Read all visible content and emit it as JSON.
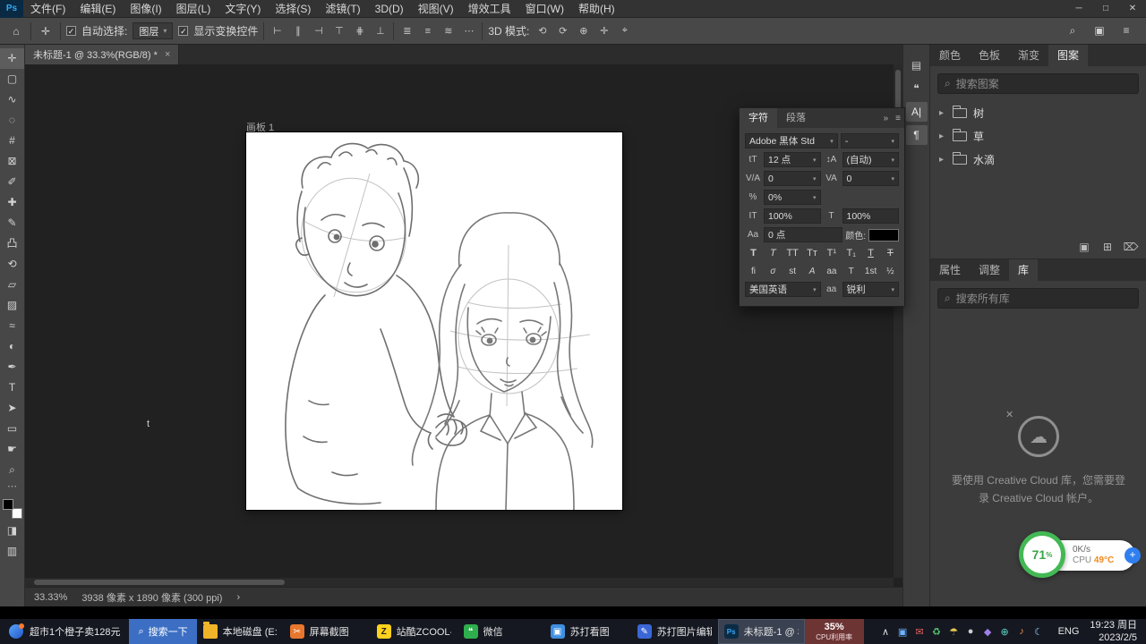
{
  "ui": {
    "dropdown_arrow": "▾",
    "check": "✓",
    "search_icon": "⌕",
    "disclosure": "▸"
  },
  "window": {
    "ps_logo": "Ps",
    "controls": {
      "minimize": "─",
      "maximize": "□",
      "close": "✕"
    }
  },
  "menubar": {
    "items": [
      "文件(F)",
      "编辑(E)",
      "图像(I)",
      "图层(L)",
      "文字(Y)",
      "选择(S)",
      "滤镜(T)",
      "3D(D)",
      "视图(V)",
      "增效工具",
      "窗口(W)",
      "帮助(H)"
    ]
  },
  "options_bar": {
    "home_icon": "⌂",
    "tool_icon": "✛",
    "auto_select_label": "自动选择:",
    "auto_select_value": "图层",
    "show_transform_label": "显示变换控件",
    "align_icons": [
      "⊢",
      "∥",
      "⊣",
      "⊤",
      "⋕",
      "⊥"
    ],
    "distribute_icons": [
      "≣",
      "≡",
      "≋"
    ],
    "more_icon": "⋯",
    "mode_3d_label": "3D 模式:",
    "mode_3d_icons": [
      "⟲",
      "⟳",
      "⊕",
      "✛",
      "⌖"
    ],
    "workspace_icon": "▣",
    "menu_icon": "≡"
  },
  "toolbar": {
    "tools": [
      {
        "name": "move",
        "glyph": "✛"
      },
      {
        "name": "marquee",
        "glyph": "▢"
      },
      {
        "name": "lasso",
        "glyph": "∿"
      },
      {
        "name": "quick-selection",
        "glyph": "◌"
      },
      {
        "name": "crop",
        "glyph": "#"
      },
      {
        "name": "frame",
        "glyph": "⊠"
      },
      {
        "name": "eyedropper",
        "glyph": "✐"
      },
      {
        "name": "spot-healing",
        "glyph": "✚"
      },
      {
        "name": "brush",
        "glyph": "✎"
      },
      {
        "name": "clone-stamp",
        "glyph": "凸"
      },
      {
        "name": "history-brush",
        "glyph": "⟲"
      },
      {
        "name": "eraser",
        "glyph": "▱"
      },
      {
        "name": "gradient",
        "glyph": "▨"
      },
      {
        "name": "blur",
        "glyph": "≈"
      },
      {
        "name": "dodge",
        "glyph": "◐"
      },
      {
        "name": "pen",
        "glyph": "✒"
      },
      {
        "name": "type",
        "glyph": "T"
      },
      {
        "name": "path-selection",
        "glyph": "➤"
      },
      {
        "name": "rectangle",
        "glyph": "▭"
      },
      {
        "name": "hand",
        "glyph": "☛"
      },
      {
        "name": "zoom",
        "glyph": "⌕"
      }
    ],
    "more_icon": "⋯",
    "mask_icon": "◨",
    "screen_mode_icon": "▥"
  },
  "document": {
    "tab_title": "未标题-1 @ 33.3%(RGB/8) *",
    "close_icon": "×",
    "artboard_label": "画板 1",
    "stray_text": "t"
  },
  "status_bar": {
    "zoom": "33.33%",
    "doc_info": "3938 像素 x 1890 像素 (300 ppi)",
    "chevron": "›"
  },
  "panel_strip": {
    "icons": [
      {
        "name": "snapshot",
        "glyph": "▤"
      },
      {
        "name": "comment",
        "glyph": "❝"
      },
      {
        "name": "character",
        "glyph": "A|"
      },
      {
        "name": "paragraph",
        "glyph": "¶"
      }
    ]
  },
  "character_panel": {
    "tabs": [
      "字符",
      "段落"
    ],
    "collapse_icon": "»",
    "menu_icon": "≡",
    "font_family": "Adobe 黑体 Std",
    "font_style": "-",
    "size_icon": "tT",
    "font_size": "12 点",
    "leading_icon": "↕A",
    "leading": "(自动)",
    "kerning_icon": "V/A",
    "kerning": "0",
    "tracking_icon": "VA",
    "tracking": "0",
    "tsume_icon": "%",
    "tsume": "0%",
    "vscale_icon": "IT",
    "vertical_scale": "100%",
    "hscale_icon": "T",
    "horizontal_scale": "100%",
    "baseline_icon": "Aa",
    "baseline_shift": "0 点",
    "color_label": "颜色:",
    "style_buttons": [
      "T",
      "T",
      "TT",
      "Tᴛ",
      "T¹",
      "T₁",
      "T",
      "T"
    ],
    "opentype_buttons": [
      "fi",
      "σ",
      "st",
      "A",
      "aa",
      "T",
      "1st",
      "½"
    ],
    "language": "美国英语",
    "antialias_label": "aa",
    "antialias": "锐利"
  },
  "patterns_panel": {
    "tabs": [
      "颜色",
      "色板",
      "渐变",
      "图案"
    ],
    "search_placeholder": "搜索图案",
    "groups": [
      {
        "name": "树"
      },
      {
        "name": "草"
      },
      {
        "name": "水滴"
      }
    ],
    "footer_icons": {
      "new_group": "▣",
      "new_pattern": "⊞",
      "delete": "⌦"
    }
  },
  "libraries_panel": {
    "tabs": [
      "属性",
      "调整",
      "库"
    ],
    "search_placeholder": "搜索所有库",
    "cc_badge": "✕",
    "cloud_icon": "☁",
    "message": "要使用 Creative Cloud 库，您需要登录 Creative Cloud 帐户。"
  },
  "perf_widget": {
    "percent": "71",
    "percent_sign": "%",
    "net_speed": "0K/s",
    "cpu_label": "CPU ",
    "cpu_temp": "49°C",
    "add_icon": "+"
  },
  "taskbar": {
    "news": {
      "label": "超市1个橙子卖128元"
    },
    "search": {
      "label": "搜索一下"
    },
    "apps": [
      {
        "label": "本地磁盘 (E:)",
        "glyph": ""
      },
      {
        "label": "屏幕截图",
        "glyph": "✂"
      },
      {
        "label": "站酷ZCOOL-...",
        "glyph": "Z"
      },
      {
        "label": "微信",
        "glyph": "❝"
      },
      {
        "label": "苏打看图",
        "glyph": "▣"
      },
      {
        "label": "苏打图片编辑",
        "glyph": "✎"
      },
      {
        "label": "未标题-1 @ 3...",
        "glyph": "Ps"
      }
    ],
    "cpu_widget": {
      "percent": "35%",
      "label": "CPU利用率"
    },
    "tray_icons": [
      "∧",
      "▣",
      "✉",
      "♻",
      "☂",
      "●",
      "◆",
      "⊕",
      "♪",
      "☾"
    ],
    "lang": "ENG",
    "clock": {
      "time": "19:23 周日",
      "date": "2023/2/5"
    }
  }
}
